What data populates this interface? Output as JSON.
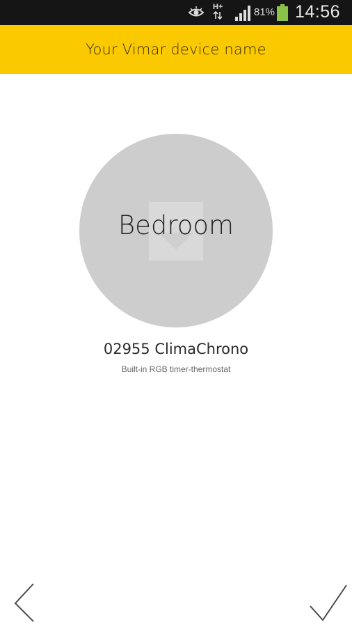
{
  "status_bar": {
    "network_label": "H+",
    "battery_percent": "81%",
    "time": "14:56",
    "icons": [
      "eye-icon",
      "network-icon",
      "signal-icon",
      "battery-icon"
    ]
  },
  "header": {
    "title": "Your Vimar device name"
  },
  "device": {
    "name": "Bedroom",
    "model": "02955 ClimaChrono",
    "description": "Built-in RGB timer-thermostat"
  },
  "navigation": {
    "back_icon": "chevron-left-icon",
    "confirm_icon": "checkmark-icon"
  },
  "colors": {
    "header_bg": "#fbc900",
    "status_bar_bg": "#151515",
    "circle_bg": "#cdcdcd"
  }
}
